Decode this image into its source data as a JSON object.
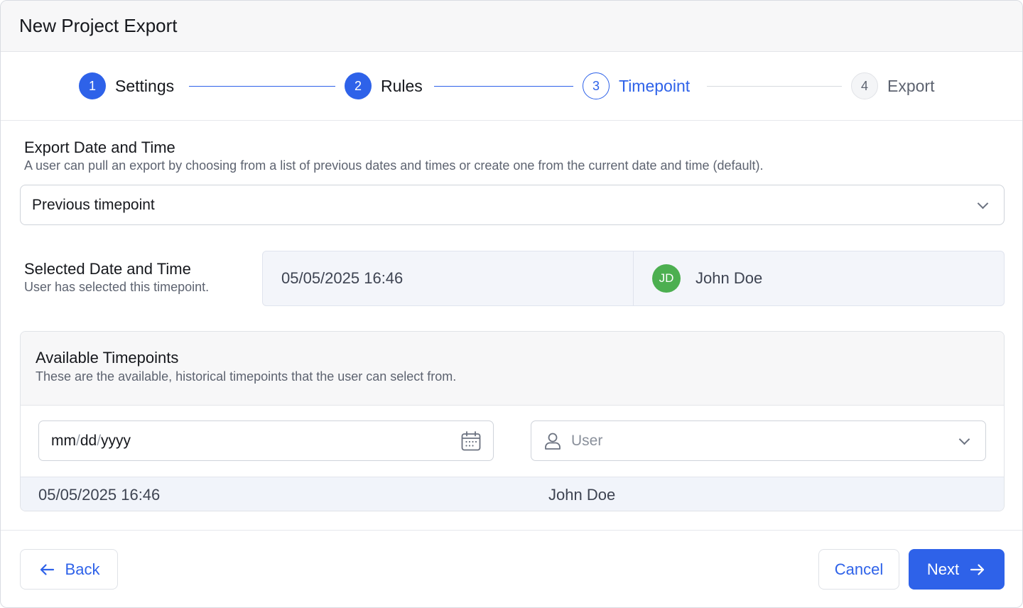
{
  "dialog": {
    "title": "New Project Export"
  },
  "stepper": {
    "steps": [
      {
        "number": "1",
        "label": "Settings",
        "state": "done"
      },
      {
        "number": "2",
        "label": "Rules",
        "state": "done"
      },
      {
        "number": "3",
        "label": "Timepoint",
        "state": "current"
      },
      {
        "number": "4",
        "label": "Export",
        "state": "todo"
      }
    ]
  },
  "export_datetime": {
    "title": "Export Date and Time",
    "description": "A user can pull an export by choosing from a list of previous dates and times or create one from the current date and time (default).",
    "select_value": "Previous timepoint",
    "select_icon": "chevron-down-icon"
  },
  "selected": {
    "title": "Selected Date and Time",
    "description": "User has selected this timepoint.",
    "datetime": "05/05/2025 16:46",
    "avatar_initials": "JD",
    "avatar_color": "#4caf50",
    "user_name": "John Doe"
  },
  "available": {
    "title": "Available Timepoints",
    "description": "These are the available, historical timepoints that the user can select from.",
    "date_filter": {
      "mm": "mm",
      "dd": "dd",
      "yyyy": "yyyy",
      "separator": "/",
      "icon": "calendar-icon"
    },
    "user_filter": {
      "placeholder": "User",
      "icon": "user-icon"
    },
    "rows": [
      {
        "datetime": "05/05/2025 16:46",
        "user": "John Doe"
      }
    ]
  },
  "footer": {
    "back_label": "Back",
    "cancel_label": "Cancel",
    "next_label": "Next"
  },
  "colors": {
    "accent": "#2e62e9",
    "avatar": "#4caf50"
  }
}
